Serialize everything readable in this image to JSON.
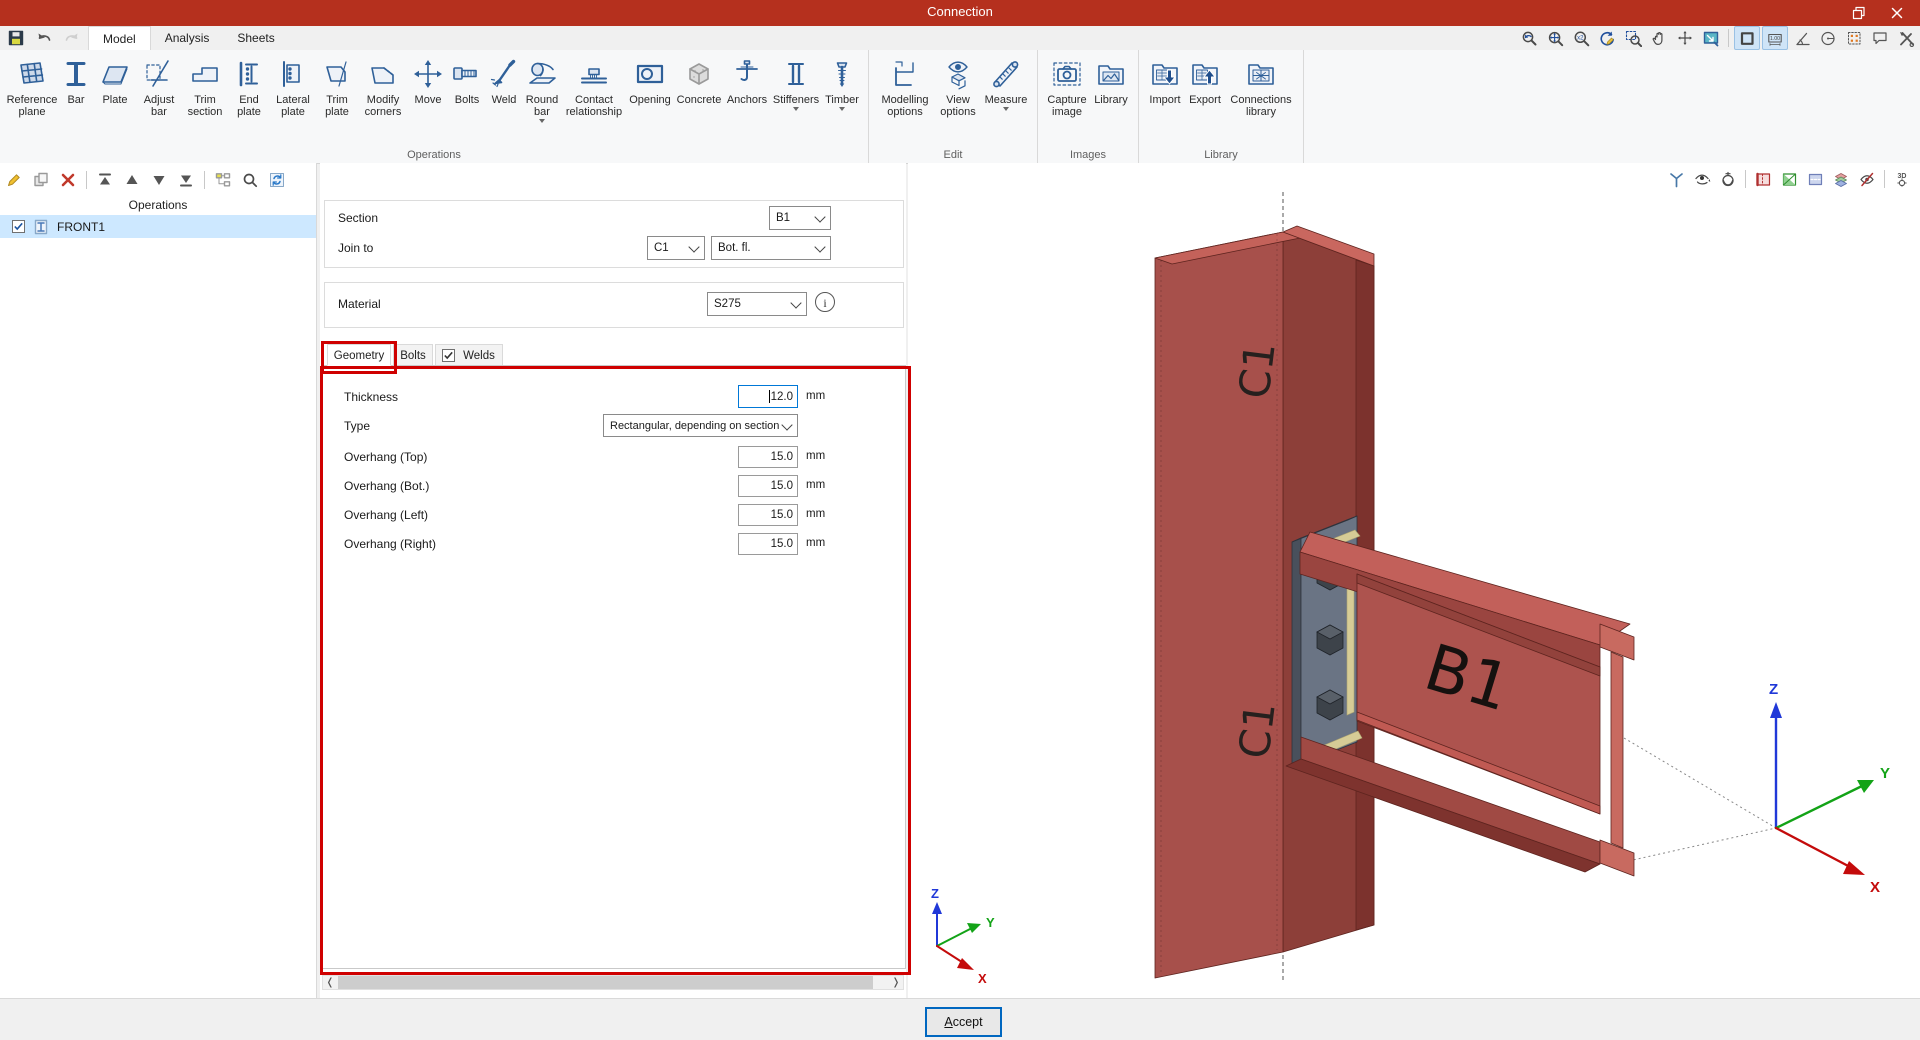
{
  "colors": {
    "titlebar_red": "#b5301e",
    "icon_blue": "#2f6099",
    "focus_blue": "#0078d7",
    "selection_blue": "#cde8ff",
    "annotation_red": "#cf0000",
    "accept_border": "#0067c0",
    "steel_face": "#ad534e",
    "steel_light": "#c4625a",
    "steel_dark": "#8d3f39",
    "plate_gray": "#6a7484",
    "weld_yellow": "#d6cc96"
  },
  "titlebar": {
    "title": "Connection",
    "buttons": [
      {
        "icon": "restore-icon"
      },
      {
        "icon": "close-icon"
      }
    ]
  },
  "menu": {
    "quick_access": [
      {
        "icon": "save-icon"
      },
      {
        "icon": "undo-icon"
      },
      {
        "icon": "redo-icon",
        "disabled": true
      },
      {
        "icon": "search-icon"
      }
    ],
    "tabs": [
      {
        "label": "Model",
        "active": true
      },
      {
        "label": "Analysis",
        "active": false
      },
      {
        "label": "Sheets",
        "active": false
      }
    ],
    "view_toolbar": [
      {
        "icon": "zoom-previous-icon"
      },
      {
        "icon": "zoom-extents-icon"
      },
      {
        "icon": "zoom-scale-icon"
      },
      {
        "icon": "redraw-icon"
      },
      {
        "icon": "zoom-window-icon"
      },
      {
        "icon": "pan-icon"
      },
      {
        "icon": "orbit-icon"
      },
      {
        "icon": "fit-view-icon"
      },
      "|",
      {
        "icon": "solid-view-icon",
        "toggled": true
      },
      {
        "icon": "dimensions-icon",
        "toggled": true
      },
      {
        "icon": "angle-icon"
      },
      {
        "icon": "arc-icon"
      },
      {
        "icon": "snap-icon"
      },
      {
        "icon": "comment-icon"
      },
      {
        "icon": "tools-icon"
      }
    ]
  },
  "ribbon": {
    "groups": [
      {
        "label": "Operations",
        "buttons": [
          {
            "label": "Reference plane",
            "icon": "reference-plane-icon"
          },
          {
            "label": "Bar",
            "icon": "bar-icon"
          },
          {
            "label": "Plate",
            "icon": "plate-icon"
          },
          {
            "label": "Adjust bar",
            "icon": "adjust-bar-icon"
          },
          {
            "label": "Trim section",
            "icon": "trim-section-icon"
          },
          {
            "label": "End plate",
            "icon": "end-plate-icon"
          },
          {
            "label": "Lateral plate",
            "icon": "lateral-plate-icon"
          },
          {
            "label": "Trim plate",
            "icon": "trim-plate-icon"
          },
          {
            "label": "Modify corners",
            "icon": "modify-corners-icon"
          },
          {
            "label": "Move",
            "icon": "move-icon"
          },
          {
            "label": "Bolts",
            "icon": "bolts-icon"
          },
          {
            "label": "Weld",
            "icon": "weld-icon"
          },
          {
            "label": "Round bar",
            "icon": "round-bar-icon",
            "menu": true
          },
          {
            "label": "Contact relationship",
            "icon": "contact-relationship-icon"
          },
          {
            "label": "Opening",
            "icon": "opening-icon"
          },
          {
            "label": "Concrete",
            "icon": "concrete-icon"
          },
          {
            "label": "Anchors",
            "icon": "anchors-icon"
          },
          {
            "label": "Stiffeners",
            "icon": "stiffeners-icon",
            "menu": true
          },
          {
            "label": "Timber",
            "icon": "timber-icon",
            "menu": true
          }
        ]
      },
      {
        "label": "Edit",
        "buttons": [
          {
            "label": "Modelling options",
            "icon": "modelling-options-icon"
          },
          {
            "label": "View options",
            "icon": "view-options-icon"
          },
          {
            "label": "Measure",
            "icon": "measure-icon",
            "menu": true
          }
        ]
      },
      {
        "label": "Images",
        "buttons": [
          {
            "label": "Capture image",
            "icon": "capture-image-icon"
          },
          {
            "label": "Library",
            "icon": "library-icon"
          }
        ]
      },
      {
        "label": "Library",
        "buttons": [
          {
            "label": "Import",
            "icon": "import-icon"
          },
          {
            "label": "Export",
            "icon": "export-icon"
          },
          {
            "label": "Connections library",
            "icon": "connections-library-icon"
          }
        ]
      }
    ]
  },
  "operations_panel": {
    "toolbar": [
      {
        "icon": "edit-pencil-icon"
      },
      {
        "icon": "duplicate-icon"
      },
      {
        "icon": "delete-icon"
      },
      "|",
      {
        "icon": "move-top-icon"
      },
      {
        "icon": "move-up-icon"
      },
      {
        "icon": "move-down-icon"
      },
      {
        "icon": "move-bottom-icon"
      },
      "|",
      {
        "icon": "tree-icon"
      },
      {
        "icon": "find-icon"
      },
      {
        "icon": "purge-icon"
      }
    ],
    "header": "Operations",
    "items": [
      {
        "label": "FRONT1",
        "checked": true,
        "selected": true,
        "icon": "beam-item-icon"
      }
    ]
  },
  "properties": {
    "section_label": "Section",
    "section_value": "B1",
    "join_to_label": "Join to",
    "join_member": "C1",
    "join_part": "Bot. fl.",
    "material_label": "Material",
    "material_value": "S275",
    "tabs": [
      {
        "label": "Geometry",
        "active": true
      },
      {
        "label": "Bolts",
        "active": false
      },
      {
        "label": "Welds",
        "active": false,
        "checked": true
      }
    ],
    "fields": [
      {
        "label": "Thickness",
        "value": "12.0",
        "unit": "mm",
        "focused": true
      },
      {
        "label": "Type",
        "value": "Rectangular, depending on section",
        "kind": "select"
      },
      {
        "label": "Overhang (Top)",
        "value": "15.0",
        "unit": "mm"
      },
      {
        "label": "Overhang (Bot.)",
        "value": "15.0",
        "unit": "mm"
      },
      {
        "label": "Overhang (Left)",
        "value": "15.0",
        "unit": "mm"
      },
      {
        "label": "Overhang (Right)",
        "value": "15.0",
        "unit": "mm"
      }
    ]
  },
  "viewport": {
    "beam_label": "B1",
    "column_label": "C1",
    "axes": {
      "x": "X",
      "y": "Y",
      "z": "Z"
    },
    "toolbar": [
      {
        "icon": "axes-triad-icon"
      },
      {
        "icon": "orbit-eye-icon"
      },
      {
        "icon": "orbit-gimbal-icon"
      },
      "|",
      {
        "icon": "clip-x-icon"
      },
      {
        "icon": "clip-y-icon"
      },
      {
        "icon": "clip-z-icon"
      },
      {
        "icon": "layers-icon"
      },
      {
        "icon": "hide-icon"
      },
      "|",
      {
        "icon": "workplane-3d-icon"
      }
    ]
  },
  "footer": {
    "accept_key": "A",
    "accept_rest": "ccept"
  }
}
